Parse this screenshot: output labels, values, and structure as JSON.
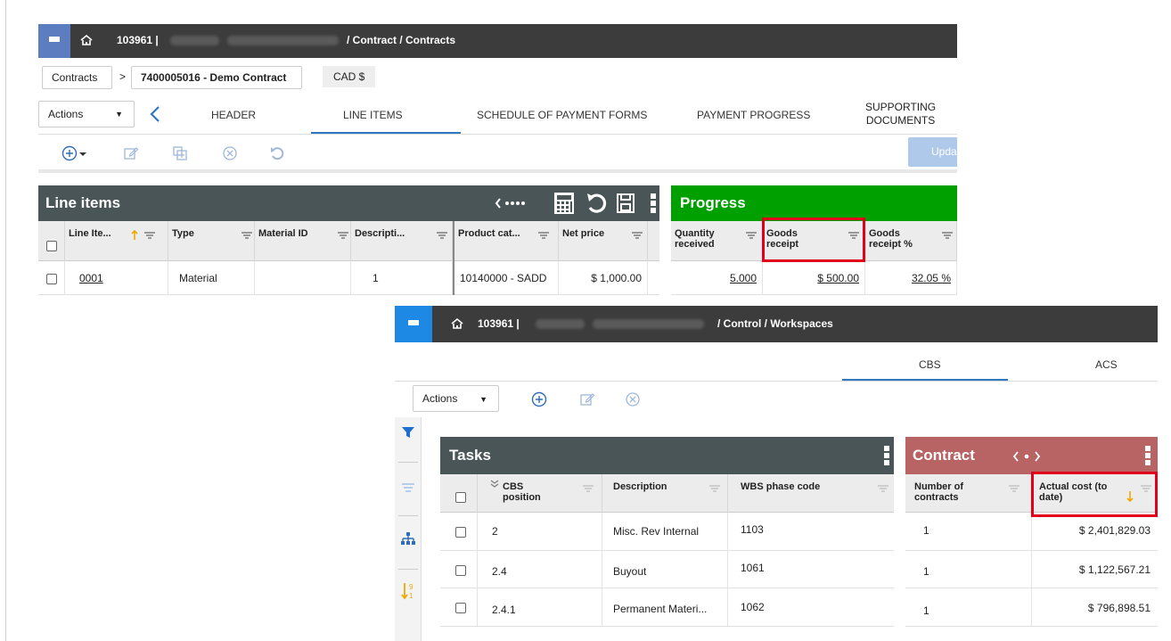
{
  "colors": {
    "topbar": "#3c3c3c",
    "menu_blue_1": "#5c7dbf",
    "menu_blue_2": "#1e88e5",
    "grid_header_dark": "#4a5558",
    "progress_green": "#00a000",
    "contract_red": "#b86464",
    "highlight_red": "#e3001b",
    "sort_arrow": "#f0a800"
  },
  "screen1": {
    "topbar": {
      "project_id": "103961 |",
      "path": "/ Contract / Contracts"
    },
    "breadcrumb": {
      "root": "Contracts",
      "separator": ">",
      "current": "7400005016 - Demo Contract",
      "currency": "CAD  $"
    },
    "tabs": {
      "actions_label": "Actions",
      "items": [
        "HEADER",
        "LINE ITEMS",
        "SCHEDULE OF  PAYMENT FORMS",
        "PAYMENT PROGRESS"
      ],
      "supporting_line1": "SUPPORTING",
      "supporting_line2": "DOCUMENTS"
    },
    "toolbar": {
      "update_label": "Upda"
    },
    "line_items": {
      "title": "Line items",
      "columns": [
        "Line Ite...",
        "Type",
        "Material ID",
        "Descripti...",
        "Product cat...",
        "Net price"
      ],
      "row": {
        "line_item": "0001",
        "type": "Material",
        "material_id": "",
        "description": "1",
        "product_cat": "10140000 - SADD",
        "net_price": "$ 1,000.00"
      }
    },
    "progress": {
      "title": "Progress",
      "columns": [
        {
          "l1": "Quantity",
          "l2": "received"
        },
        {
          "l1": "Goods",
          "l2": "receipt"
        },
        {
          "l1": "Goods",
          "l2": "receipt %"
        }
      ],
      "row": {
        "quantity_received": "5.000",
        "goods_receipt": "$ 500.00",
        "goods_receipt_pct": "32.05 %"
      }
    }
  },
  "screen2": {
    "topbar": {
      "project_id": "103961 |",
      "path": "/ Control / Workspaces"
    },
    "tabs": [
      "CBS",
      "ACS"
    ],
    "actions_label": "Actions",
    "tasks": {
      "title": "Tasks",
      "columns": [
        {
          "l1": "CBS",
          "l2": "position"
        },
        {
          "l1": "Description",
          "l2": ""
        },
        {
          "l1": "WBS phase code",
          "l2": ""
        }
      ],
      "rows": [
        {
          "cbs": "2",
          "description": "Misc. Rev Internal",
          "wbs": "1103"
        },
        {
          "cbs": "2.4",
          "description": "Buyout",
          "wbs": "1061"
        },
        {
          "cbs": "2.4.1",
          "description": "Permanent Materi...",
          "wbs": "1062"
        }
      ]
    },
    "contract": {
      "title": "Contract",
      "columns": [
        {
          "l1": "Number of",
          "l2": "contracts"
        },
        {
          "l1": "Actual cost (to",
          "l2": "date)"
        }
      ],
      "rows": [
        {
          "num": "1",
          "cost": "$ 2,401,829.03"
        },
        {
          "num": "1",
          "cost": "$ 1,122,567.21"
        },
        {
          "num": "1",
          "cost": "$ 796,898.51"
        }
      ]
    }
  }
}
